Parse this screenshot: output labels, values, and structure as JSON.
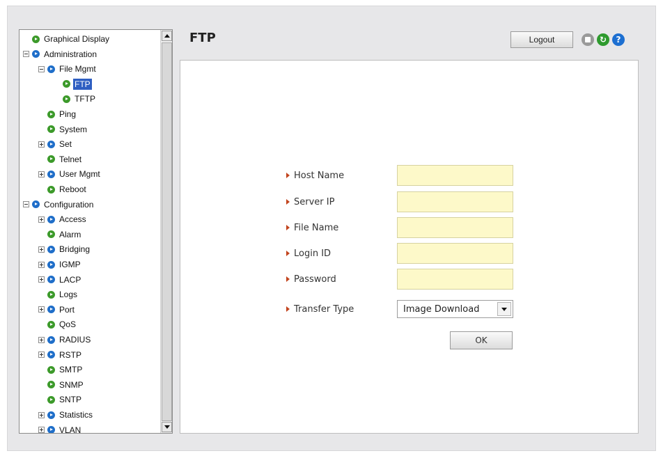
{
  "header": {
    "title": "FTP",
    "logout_label": "Logout",
    "icons": [
      "save-icon",
      "refresh-icon",
      "help-icon"
    ]
  },
  "tree": {
    "items": [
      {
        "label": "Graphical Display",
        "toggle": "none",
        "dot": "green"
      },
      {
        "label": "Administration",
        "toggle": "minus",
        "dot": "blue"
      },
      {
        "label": "File Mgmt",
        "toggle": "minus",
        "dot": "blue"
      },
      {
        "label": "FTP",
        "toggle": "none",
        "dot": "green",
        "selected": true
      },
      {
        "label": "TFTP",
        "toggle": "none",
        "dot": "green"
      },
      {
        "label": "Ping",
        "toggle": "none",
        "dot": "green"
      },
      {
        "label": "System",
        "toggle": "none",
        "dot": "green"
      },
      {
        "label": "Set",
        "toggle": "plus",
        "dot": "blue"
      },
      {
        "label": "Telnet",
        "toggle": "none",
        "dot": "green"
      },
      {
        "label": "User Mgmt",
        "toggle": "plus",
        "dot": "blue"
      },
      {
        "label": "Reboot",
        "toggle": "none",
        "dot": "green"
      },
      {
        "label": "Configuration",
        "toggle": "minus",
        "dot": "blue"
      },
      {
        "label": "Access",
        "toggle": "plus",
        "dot": "blue"
      },
      {
        "label": "Alarm",
        "toggle": "none",
        "dot": "green"
      },
      {
        "label": "Bridging",
        "toggle": "plus",
        "dot": "blue"
      },
      {
        "label": "IGMP",
        "toggle": "plus",
        "dot": "blue"
      },
      {
        "label": "LACP",
        "toggle": "plus",
        "dot": "blue"
      },
      {
        "label": "Logs",
        "toggle": "none",
        "dot": "green"
      },
      {
        "label": "Port",
        "toggle": "plus",
        "dot": "blue"
      },
      {
        "label": "QoS",
        "toggle": "none",
        "dot": "green"
      },
      {
        "label": "RADIUS",
        "toggle": "plus",
        "dot": "blue"
      },
      {
        "label": "RSTP",
        "toggle": "plus",
        "dot": "blue"
      },
      {
        "label": "SMTP",
        "toggle": "none",
        "dot": "green"
      },
      {
        "label": "SNMP",
        "toggle": "none",
        "dot": "green"
      },
      {
        "label": "SNTP",
        "toggle": "none",
        "dot": "green"
      },
      {
        "label": "Statistics",
        "toggle": "plus",
        "dot": "blue"
      },
      {
        "label": "VLAN",
        "toggle": "plus",
        "dot": "blue"
      }
    ]
  },
  "form": {
    "host_name_label": "Host Name",
    "host_name_value": "",
    "server_ip_label": "Server IP",
    "server_ip_value": "",
    "file_name_label": "File Name",
    "file_name_value": "",
    "login_id_label": "Login ID",
    "login_id_value": "",
    "password_label": "Password",
    "password_value": "",
    "transfer_type_label": "Transfer Type",
    "transfer_type_value": "Image Download",
    "ok_label": "OK"
  },
  "colors": {
    "input_background": "#fdf9c9",
    "selection": "#2f5fc2",
    "label_arrow": "#c2451f",
    "expandable_dot": "#1f6ec9",
    "leaf_dot": "#3c9a2a"
  }
}
